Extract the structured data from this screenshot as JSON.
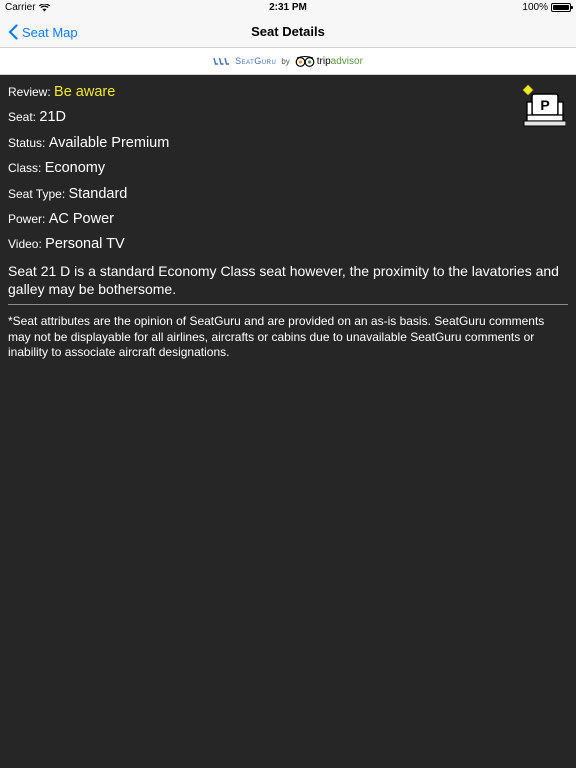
{
  "status_bar": {
    "carrier": "Carrier",
    "time": "2:31 PM",
    "battery": "100%"
  },
  "nav": {
    "back_label": "Seat Map",
    "title": "Seat Details"
  },
  "banner": {
    "seatguru": "SeatGuru",
    "by": "by",
    "tripadvisor_a": "trip",
    "tripadvisor_b": "advisor"
  },
  "details": {
    "review": {
      "label": "Review:",
      "value": "Be aware"
    },
    "seat": {
      "label": "Seat:",
      "value": "21D"
    },
    "status": {
      "label": "Status:",
      "value": "Available Premium"
    },
    "class": {
      "label": "Class:",
      "value": "Economy"
    },
    "seat_type": {
      "label": "Seat Type:",
      "value": "Standard"
    },
    "power": {
      "label": "Power:",
      "value": "AC Power"
    },
    "video": {
      "label": "Video:",
      "value": "Personal TV"
    }
  },
  "seat_icon_letter": "P",
  "description": "Seat 21 D is a standard Economy Class seat however, the proximity to the lavatories and galley may be bothersome.",
  "disclaimer": "*Seat attributes are the opinion of SeatGuru and are provided on an as-is basis. SeatGuru comments may not be displayable for all airlines, aircrafts or cabins due to unavailable SeatGuru comments or inability to associate aircraft designations.",
  "colors": {
    "background": "#262626",
    "accent_blue": "#0a7aff",
    "warning_yellow": "#f2e92c"
  }
}
